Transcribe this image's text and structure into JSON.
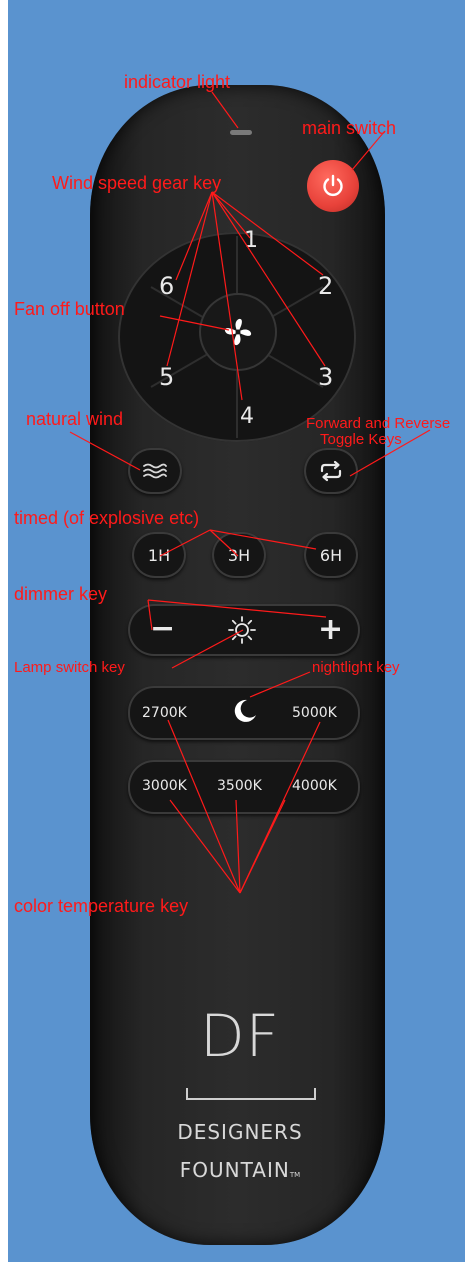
{
  "annotations": {
    "indicator_light": "indicator light",
    "main_switch": "main switch",
    "wind_speed_gear_key": "Wind speed gear key",
    "fan_off_button": "Fan off button",
    "natural_wind": "natural wind",
    "forward_reverse_line1": "Forward and Reverse",
    "forward_reverse_line2": "Toggle Keys",
    "timed": "timed (of explosive etc)",
    "dimmer_key": "dimmer key",
    "lamp_switch_key": "Lamp switch key",
    "nightlight_key": "nightlight key",
    "color_temperature_key": "color temperature key"
  },
  "remote": {
    "speed_keys": [
      "1",
      "2",
      "3",
      "4",
      "5",
      "6"
    ],
    "timer_keys": [
      "1H",
      "3H",
      "6H"
    ],
    "dimmer_minus": "−",
    "dimmer_plus": "+",
    "color_keys_top": [
      "2700K",
      "5000K"
    ],
    "color_keys_bottom": [
      "3000K",
      "3500K",
      "4000K"
    ],
    "brand_mark": "DF",
    "brand_line1": "DESIGNERS",
    "brand_line2": "FOUNTAIN",
    "brand_tm": "TM"
  },
  "icons": {
    "power": "power-icon",
    "fan": "fan-icon",
    "natural_wind": "wind-waves-icon",
    "reverse": "repeat-arrows-icon",
    "lamp": "sun-icon",
    "nightlight": "moon-icon"
  },
  "colors": {
    "background": "#5a93cf",
    "remote": "#262626",
    "power_button": "#e8423a",
    "annotation": "#ff1a1a",
    "key_text": "#e9e9e9"
  }
}
